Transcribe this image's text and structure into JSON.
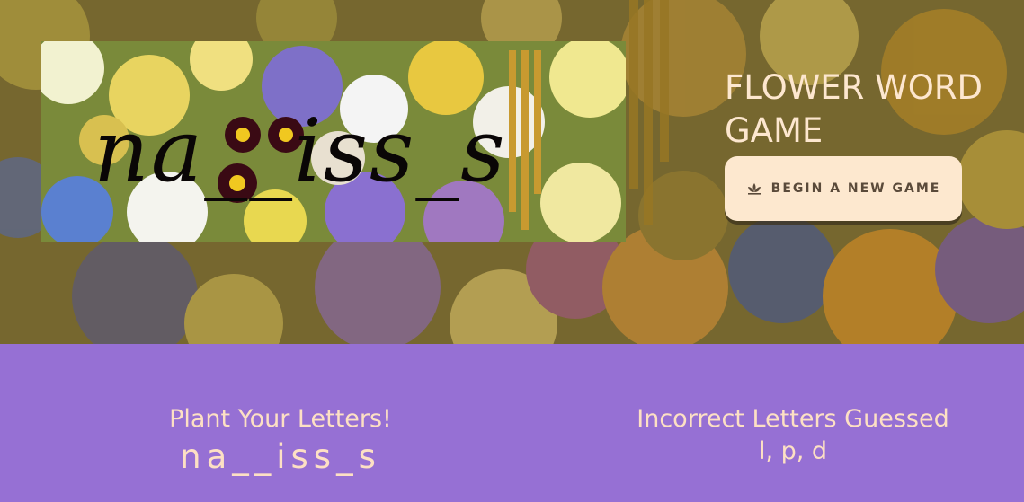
{
  "header": {
    "banner_word": "na__iss_s",
    "title": "FLOWER WORD GAME",
    "new_game_label": "BEGIN A NEW GAME",
    "new_game_icon": "lotus-icon"
  },
  "game": {
    "plant_heading": "Plant Your Letters!",
    "current_word": "na__iss_s",
    "incorrect_heading": "Incorrect Letters Guessed",
    "incorrect_letters": "l, p, d"
  },
  "colors": {
    "bottom_panel": "#9670d4",
    "text_cream": "#fde0c4",
    "button_bg": "#fde8cf"
  }
}
